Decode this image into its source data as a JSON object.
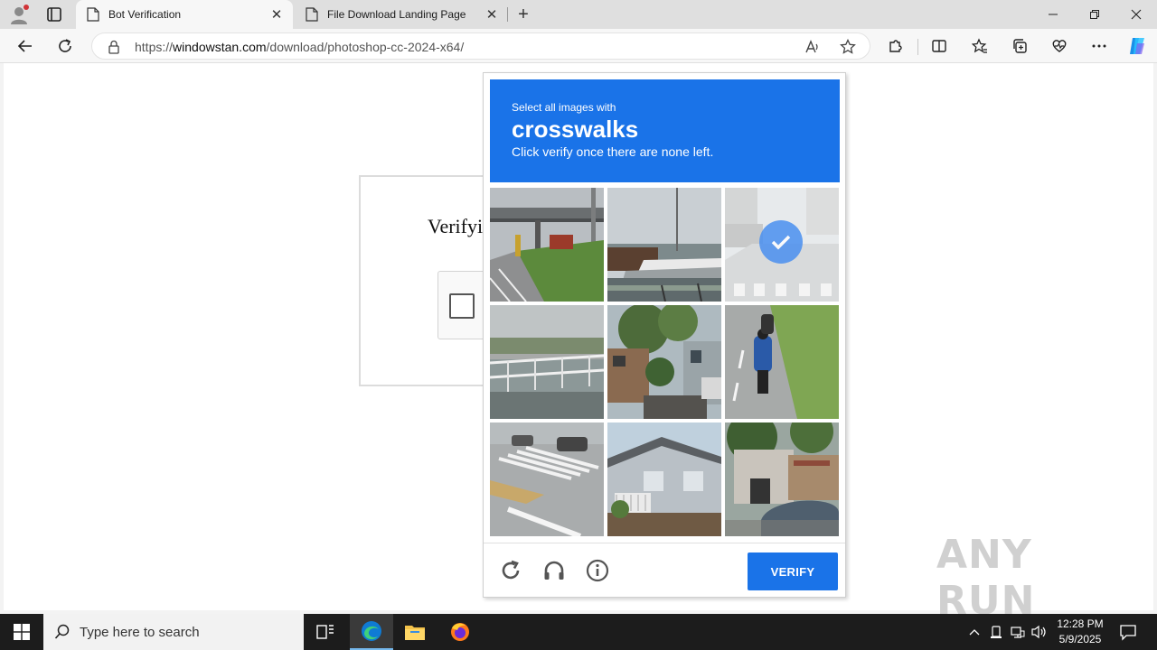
{
  "browser": {
    "tabs": [
      {
        "title": "Bot Verification",
        "active": true
      },
      {
        "title": "File Download Landing Page",
        "active": false
      }
    ],
    "address": {
      "prefix": "https://",
      "domain": "windowstan.com",
      "path": "/download/photoshop-cc-2024-x64/"
    }
  },
  "page": {
    "verify_title": "Verifyi"
  },
  "captcha": {
    "instruction": "Select all images with",
    "target": "crosswalks",
    "hint": "Click verify once there are none left.",
    "verify_label": "VERIFY",
    "tiles": [
      {
        "scene": "overpass-road",
        "selected": false
      },
      {
        "scene": "boats-harbor",
        "selected": false
      },
      {
        "scene": "street-crosswalk",
        "selected": true
      },
      {
        "scene": "bridge-railing",
        "selected": false
      },
      {
        "scene": "houses-trees",
        "selected": false
      },
      {
        "scene": "motorbike-road",
        "selected": false
      },
      {
        "scene": "intersection-crosswalk",
        "selected": false
      },
      {
        "scene": "house-facade",
        "selected": false
      },
      {
        "scene": "parked-car-street",
        "selected": false
      }
    ]
  },
  "watermark": "ANY RUN",
  "taskbar": {
    "search_placeholder": "Type here to search",
    "time": "12:28 PM",
    "date": "5/9/2025"
  },
  "colors": {
    "accent": "#1a73e8",
    "taskbar": "#1c1c1c"
  }
}
